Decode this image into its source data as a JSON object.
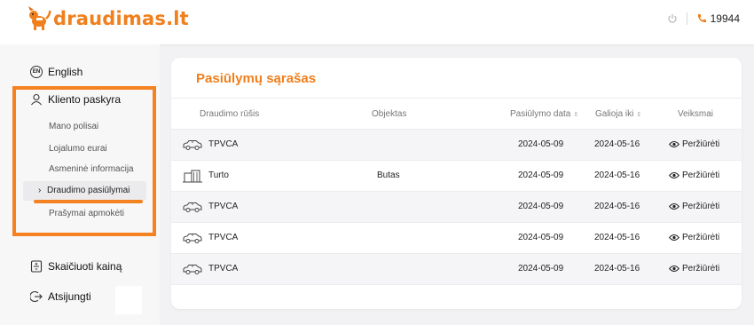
{
  "header": {
    "logo_text": "draudimas",
    "logo_tld": ".lt",
    "phone": "19944",
    "icons": [
      "logout-icon",
      "phone-icon"
    ]
  },
  "sidebar": {
    "language": "English",
    "language_badge": "EN",
    "account": "Kliento paskyra",
    "sub_items": [
      "Mano polisai",
      "Lojalumo eurai",
      "Asmeninė informacija",
      "Draudimo pasiūlymai",
      "Prašymai apmokėti"
    ],
    "active_prefix": "›",
    "calculate": "Skaičiuoti kainą",
    "logout": "Atsijungti"
  },
  "offers": {
    "title": "Pasiūlymų sąrašas",
    "columns": [
      "Draudimo rūšis",
      "Objektas",
      "Pasiūlymo data",
      "Galioja iki",
      "Veiksmai"
    ],
    "sort_glyph": "⇕",
    "view_label": "Peržiūrėti",
    "rows": [
      {
        "type": "TPVCA",
        "icon": "car-icon",
        "object": "",
        "date": "2024-05-09",
        "valid": "2024-05-16"
      },
      {
        "type": "Turto",
        "icon": "building-icon",
        "object": "Butas",
        "date": "2024-05-09",
        "valid": "2024-05-16"
      },
      {
        "type": "TPVCA",
        "icon": "car-icon",
        "object": "",
        "date": "2024-05-09",
        "valid": "2024-05-16"
      },
      {
        "type": "TPVCA",
        "icon": "car-icon",
        "object": "",
        "date": "2024-05-09",
        "valid": "2024-05-16"
      },
      {
        "type": "TPVCA",
        "icon": "car-icon",
        "object": "",
        "date": "2024-05-09",
        "valid": "2024-05-16"
      }
    ]
  },
  "colors": {
    "brand": "#f07f1c",
    "highlight": "#f58220"
  }
}
